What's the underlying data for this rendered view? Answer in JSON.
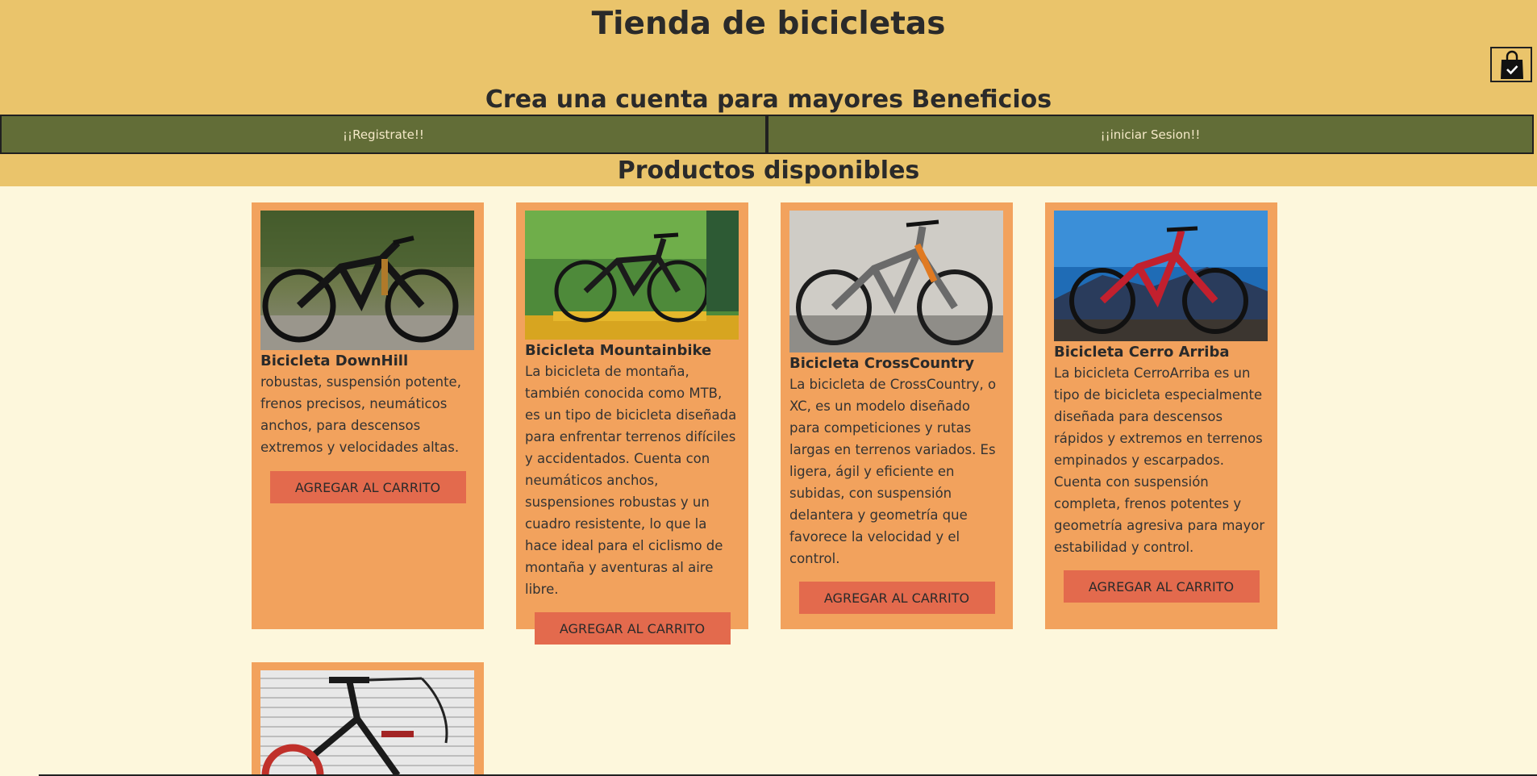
{
  "header": {
    "title": "Tienda de bicicletas",
    "promo": "Crea una cuenta para mayores Beneficios",
    "register_label": "¡¡Registrate!!",
    "login_label": "¡¡iniciar Sesion!!",
    "cart_icon": "shopping-bag-check-icon"
  },
  "products_section": {
    "title": "Productos disponibles"
  },
  "products": [
    {
      "name": "Bicicleta DownHill",
      "description": "robustas, suspensión potente, frenos precisos, neumáticos anchos, para descensos extremos y velocidades altas.",
      "button": "AGREGAR AL CARRITO",
      "image": "black downhill mountain bike on forest rocks"
    },
    {
      "name": "Bicicleta Mountainbike",
      "description": "La bicicleta de montaña, también conocida como MTB, es un tipo de bicicleta diseñada para enfrentar terrenos difíciles y accidentados. Cuenta con neumáticos anchos, suspensiones robustas y un cuadro resistente, lo que la hace ideal para el ciclismo de montaña y aventuras al aire libre.",
      "button": "AGREGAR AL CARRITO",
      "image": "mountain bike on yellow display stand"
    },
    {
      "name": "Bicicleta CrossCountry",
      "description": "La bicicleta de CrossCountry, o XC, es un modelo diseñado para competiciones y rutas largas en terrenos variados. Es ligera, ágil y eficiente en subidas, con suspensión delantera y geometría que favorece la velocidad y el control.",
      "button": "AGREGAR AL CARRITO",
      "image": "grey cross country bike against concrete wall"
    },
    {
      "name": "Bicicleta Cerro Arriba",
      "description": "La bicicleta CerroArriba es un tipo de bicicleta especialmente diseñada para descensos rápidos y extremos en terrenos empinados y escarpados. Cuenta con suspensión completa, frenos potentes y geometría agresiva para mayor estabilidad y control.",
      "button": "AGREGAR AL CARRITO",
      "image": "red e-mountain bike under blue sky"
    },
    {
      "name": "",
      "description": "",
      "button": "",
      "image": "BMX bike with red wheels against metal shutter"
    }
  ],
  "colors": {
    "header_bg": "#eac46b",
    "page_bg": "#fdf7dc",
    "auth_bg": "#626d37",
    "card_bg": "#f2a25d",
    "button_bg": "#e36a4d"
  }
}
